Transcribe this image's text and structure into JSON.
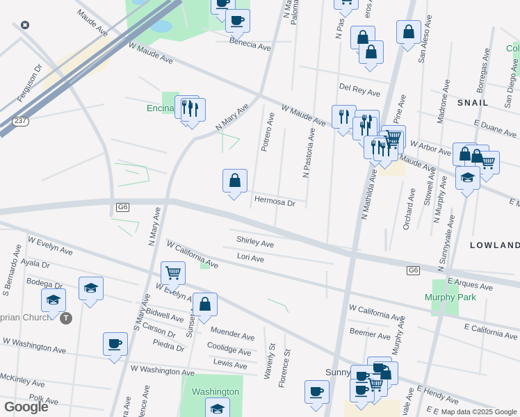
{
  "colors": {
    "background": "#f5f3f3",
    "road": "#d4dbe3",
    "highway": "#8ea2bd",
    "park": "#b7eccb",
    "water": "#9dd8ee",
    "marker_fill": "#e4ecfb",
    "marker_border": "#6c93d8",
    "icon": "#0b4a6f"
  },
  "labels": {
    "maude_nw": "Maude Ave",
    "w_maude_1": "W Maude Ave",
    "w_maude_2": "W Maude Ave",
    "maude_e": "Maude Ave",
    "e_m": "E M",
    "benecia": "Benecia Ave",
    "ferguson": "Ferguson Dr",
    "n_mary": "N Mary Ave",
    "n_mary_2": "N Mary Ave",
    "s_mary": "S Mary Ave",
    "potrero": "Potrero Ave",
    "hermosa": "Hermosa Dr",
    "n_pastoria": "N Pastoria Ave",
    "n_mathilda": "N Mathilda Ave",
    "del_rey": "Del Rey Ave",
    "pine": "Pine Ave",
    "madrone": "Madrone Ave",
    "borregas": "Borregas Ave",
    "san_aleso": "San Aleso Ave",
    "san_diego": "San Diego Ave",
    "e_duane": "E Duane Ave",
    "w_arbor": "W Arbor Ave",
    "orchard": "Orchard Ave",
    "stowell": "Stowell Ave",
    "n_murphy": "N Murphy Ave",
    "n_sunnyvale": "N Sunnyvale Ave",
    "e_arques": "E Arques Ave",
    "shirley": "Shirley Ave",
    "lori": "Lori Ave",
    "w_california": "W California Ave",
    "w_california_2": "W California Ave",
    "e_california": "E California Ave",
    "w_evelyn": "W Evelyn Ave",
    "w_evelyn_2": "W Evelyn Ave",
    "s_bernardo": "S Bernardo Ave",
    "ayala": "Ayala Dr",
    "bodega": "Bodega Dr",
    "bidwell": "Bidwell Ave",
    "carson": "Carson Dr",
    "piedra": "Piedra Dr",
    "sunset": "Sunset Ave",
    "muender": "Muender Ave",
    "coolidge": "Coolidge Ave",
    "lewis": "Lewis Ave",
    "w_washington": "W Washington Ave",
    "w_washington_2": "W Washington Ave",
    "mckinley": "McKinley Ave",
    "polk": "Polk Ave",
    "waverly": "Waverly St",
    "florence": "Florence St",
    "beemer": "Beemer Ave",
    "murphy": "Murphy Ave",
    "s_sunnyvale": "vale Ave",
    "e_hendy": "E Hendy Ave",
    "e_e": "E E",
    "paloma": "Paloma",
    "n_pastoria_top": "N Pas",
    "carneros": "eros Ave",
    "n_ma_top": "N Ma",
    "lence": "lence Ave",
    "ra": "ra Ave",
    "snail": "SNAIL",
    "lowland": "LOWLAND",
    "encina": "Encina",
    "murphy_park": "Murphy Park",
    "washington": "Washington",
    "col": "Col",
    "church": "prian Church",
    "sunny": "Sunny"
  },
  "shields": {
    "hwy237": "237",
    "g6_a": "G6",
    "g6_b": "G6"
  },
  "attribution": {
    "logo": "Google",
    "map_data": "Map data ©2025 Google"
  }
}
